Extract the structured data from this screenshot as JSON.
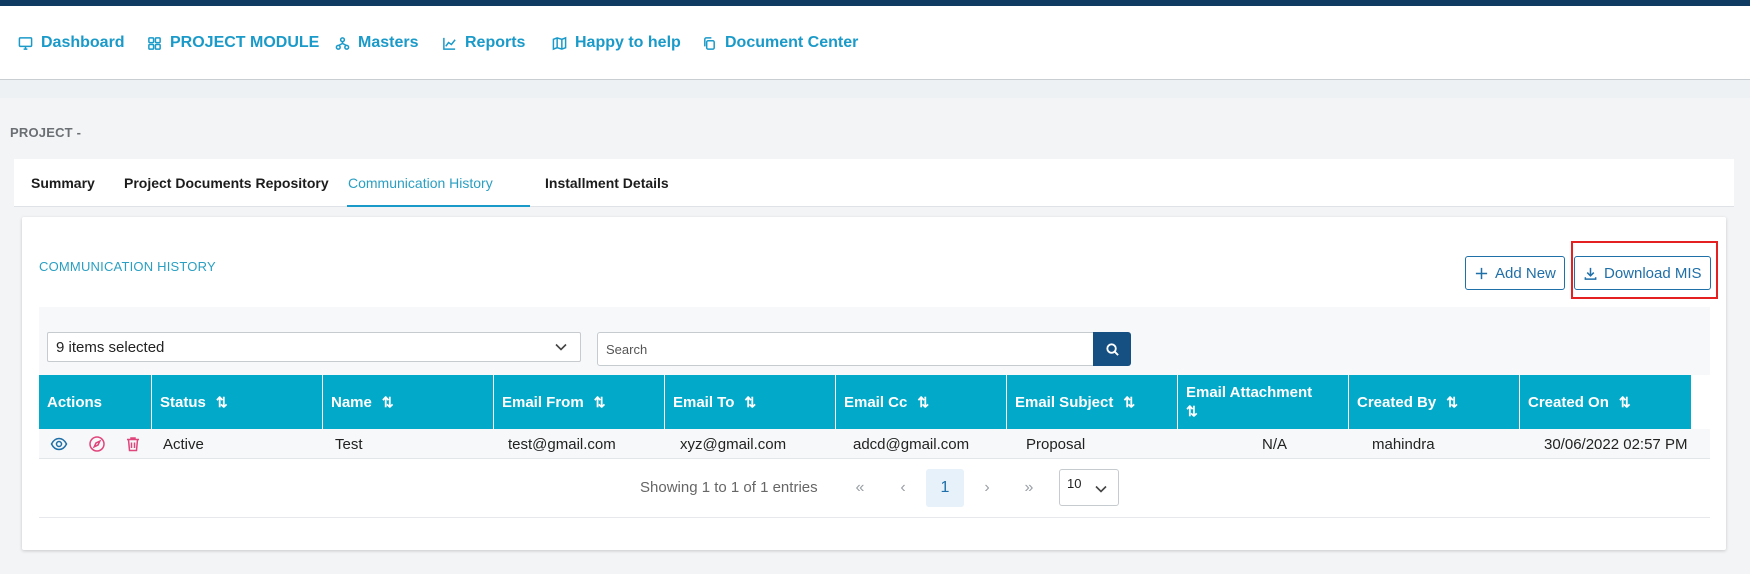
{
  "nav": {
    "items": [
      {
        "label": "Dashboard",
        "icon": "monitor-icon"
      },
      {
        "label": "PROJECT MODULE",
        "icon": "grid-icon"
      },
      {
        "label": "Masters",
        "icon": "sitemap-icon"
      },
      {
        "label": "Reports",
        "icon": "chart-icon"
      },
      {
        "label": "Happy to help",
        "icon": "map-icon"
      },
      {
        "label": "Document Center",
        "icon": "copy-icon"
      }
    ]
  },
  "page": {
    "title": "PROJECT -"
  },
  "tabs": [
    {
      "label": "Summary",
      "active": false
    },
    {
      "label": "Project Documents Repository",
      "active": false
    },
    {
      "label": "Communication History",
      "active": true
    },
    {
      "label": "Installment Details",
      "active": false
    }
  ],
  "card": {
    "title": "COMMUNICATION HISTORY",
    "add_new_label": "Add New",
    "download_label": "Download MIS"
  },
  "filters": {
    "columns_selected": "9 items selected",
    "search_placeholder": "Search"
  },
  "table": {
    "columns": [
      {
        "label": "Actions",
        "sortable": false
      },
      {
        "label": "Status",
        "sortable": true
      },
      {
        "label": "Name",
        "sortable": true
      },
      {
        "label": "Email From",
        "sortable": true
      },
      {
        "label": "Email To",
        "sortable": true
      },
      {
        "label": "Email Cc",
        "sortable": true
      },
      {
        "label": "Email Subject",
        "sortable": true
      },
      {
        "label": "Email Attachment",
        "sortable": true
      },
      {
        "label": "Created By",
        "sortable": true
      },
      {
        "label": "Created On",
        "sortable": true
      }
    ],
    "sort_glyph": "⇅",
    "rows": [
      {
        "status": "Active",
        "name": "Test",
        "email_from": "test@gmail.com",
        "email_to": "xyz@gmail.com",
        "email_cc": "adcd@gmail.com",
        "email_subject": "Proposal",
        "email_attachment": "N/A",
        "created_by": "mahindra",
        "created_on": "30/06/2022 02:57 PM"
      }
    ]
  },
  "pagination": {
    "info": "Showing 1 to 1 of 1 entries",
    "first": "«",
    "prev": "‹",
    "current_page": "1",
    "next": "›",
    "last": "»",
    "page_size": "10"
  },
  "colors": {
    "accent": "#1a9ac9",
    "header_bg": "#03a9c9",
    "primary_dark": "#164f82",
    "highlight": "#e52020"
  }
}
